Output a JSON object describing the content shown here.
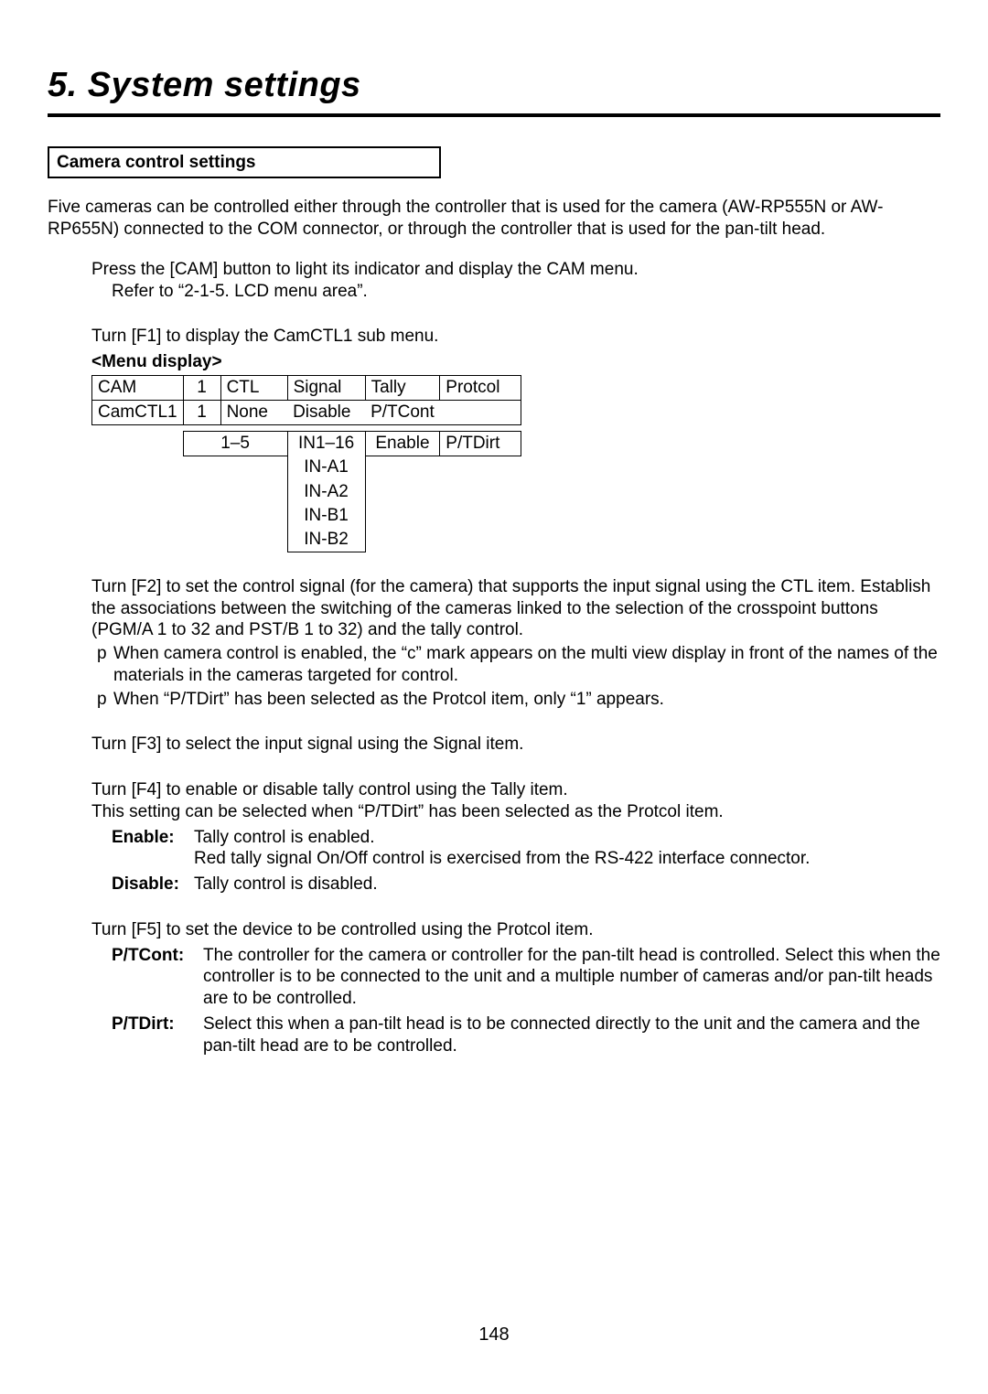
{
  "chapter": "5. System settings",
  "section_box": "Camera control settings",
  "intro": "Five cameras can be controlled either through the controller that is used for the camera (AW-RP555N or AW-RP655N) connected to the COM connector, or through the controller that is used for the pan-tilt head.",
  "step1_line1": "Press the [CAM] button to light its indicator and display the CAM menu.",
  "step1_line2": "Refer to “2-1-5. LCD menu area”.",
  "step2": "Turn [F1] to display the CamCTL1 sub menu.",
  "menu_display_label": "<Menu display>",
  "lcd": {
    "row1": {
      "c1": "CAM",
      "c2": "1",
      "c3": "CTL",
      "c4": "Signal",
      "c5": "Tally",
      "c6": "Protcol"
    },
    "row2": {
      "c1": "CamCTL1",
      "c2": "1",
      "c3": "None",
      "c4": "Disable",
      "c5": "P/TCont"
    },
    "opts": {
      "ctl": "1–5",
      "signal": [
        "IN1–16",
        "IN-A1",
        "IN-A2",
        "IN-B1",
        "IN-B2"
      ],
      "tally": "Enable",
      "protcol": "P/TDirt"
    }
  },
  "step3_p1": "Turn [F2] to set the control signal (for the camera) that supports the input signal using the CTL item. Establish the associations between the switching of the cameras linked to the selection of the crosspoint buttons (PGM/A 1 to 32 and PST/B 1 to 32) and the tally control.",
  "step3_b1": "When camera control is enabled, the “c” mark appears on the multi view display in front of the names of the materials in the cameras targeted for control.",
  "step3_b2": "When “P/TDirt” has been selected as the Protcol item, only “1” appears.",
  "step4": "Turn [F3] to select the input signal using the Signal item.",
  "step5_l1": "Turn [F4] to enable or disable tally control using the Tally item.",
  "step5_l2": "This setting can be selected when “P/TDirt” has been selected as the Protcol item.",
  "enable_term": "Enable:",
  "enable_def1": "Tally control is enabled.",
  "enable_def2": "Red tally signal On/Off control is exercised from the RS-422 interface connector.",
  "disable_term": "Disable:",
  "disable_def": "Tally control is disabled.",
  "step6": "Turn [F5] to set the device to be controlled using the Protcol item.",
  "ptcont_term": "P/TCont:",
  "ptcont_def": "The controller for the camera or controller for the pan-tilt head is controlled. Select this when the controller is to be connected to the unit and a multiple number of cameras and/or pan-tilt heads are to be controlled.",
  "ptdirt_term": "P/TDirt:",
  "ptdirt_def": "Select this when a pan-tilt head is to be connected directly to the unit and the camera and the pan-tilt head are to be controlled.",
  "bullet": "p",
  "page_number": "148"
}
